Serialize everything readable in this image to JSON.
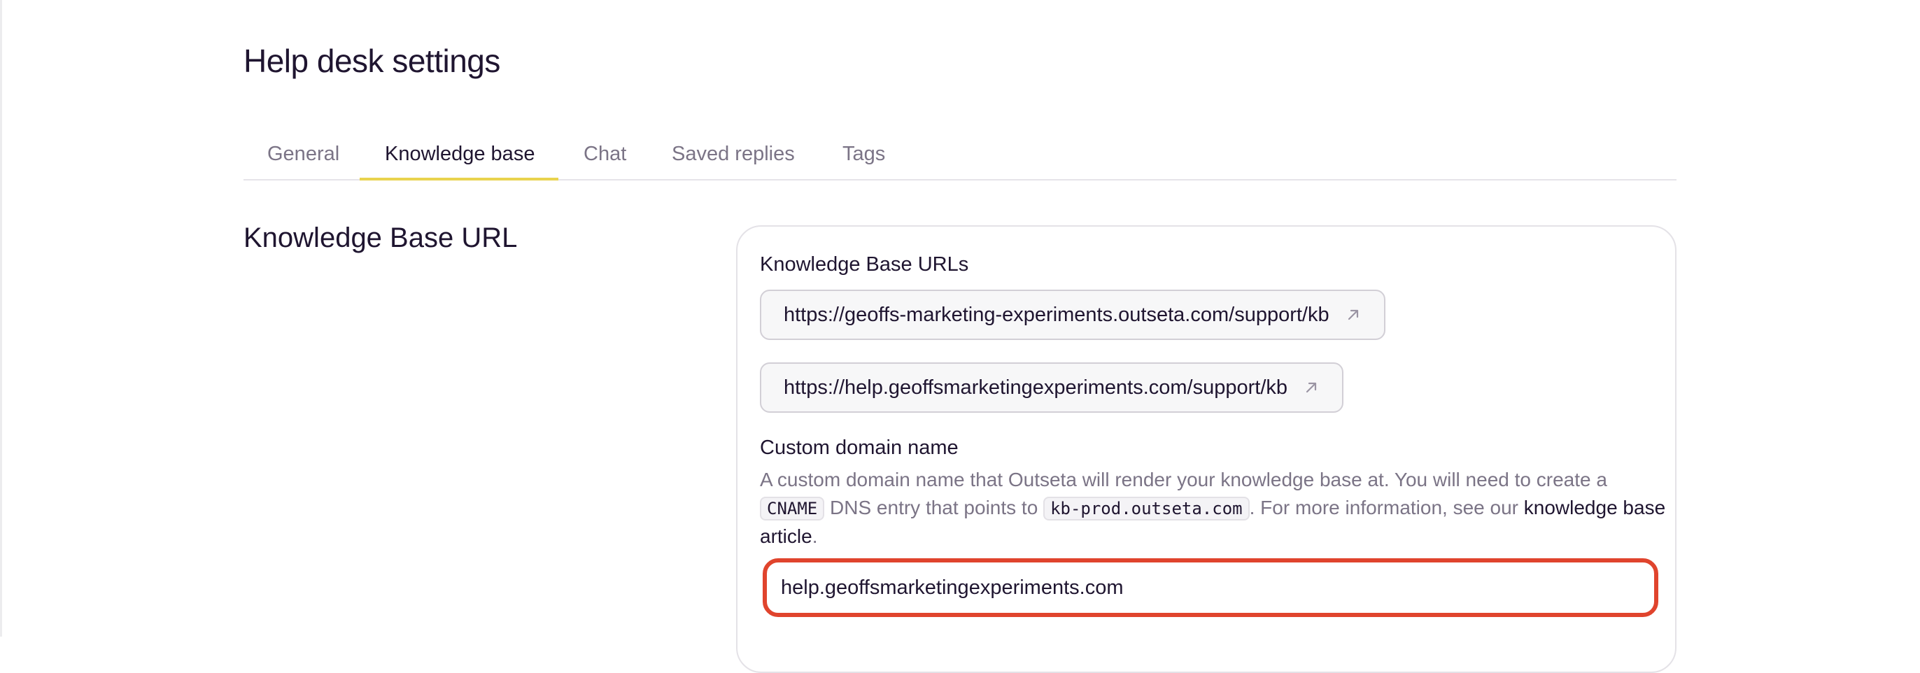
{
  "page": {
    "title": "Help desk settings"
  },
  "tabs": [
    {
      "label": "General",
      "active": false
    },
    {
      "label": "Knowledge base",
      "active": true
    },
    {
      "label": "Chat",
      "active": false
    },
    {
      "label": "Saved replies",
      "active": false
    },
    {
      "label": "Tags",
      "active": false
    }
  ],
  "section": {
    "heading": "Knowledge Base URL"
  },
  "kb_urls": {
    "label": "Knowledge Base URLs",
    "items": [
      {
        "url": "https://geoffs-marketing-experiments.outseta.com/support/kb",
        "icon": "external-link-icon"
      },
      {
        "url": "https://help.geoffsmarketingexperiments.com/support/kb",
        "icon": "external-link-icon"
      }
    ]
  },
  "custom_domain": {
    "label": "Custom domain name",
    "help_part1": "A custom domain name that Outseta will render your knowledge base at. You will need to create a ",
    "code1": "CNAME",
    "help_part2": " DNS entry that points to ",
    "code2": "kb-prod.outseta.com",
    "help_part3": ". For more information, see our ",
    "link_text": "knowledge base article",
    "help_part4": ".",
    "value": "help.geoffsmarketingexperiments.com"
  },
  "colors": {
    "accent_underline": "#e9d34e",
    "input_focus_border": "#e0442d",
    "text_primary": "#1f1530",
    "text_muted": "#7b7486"
  }
}
